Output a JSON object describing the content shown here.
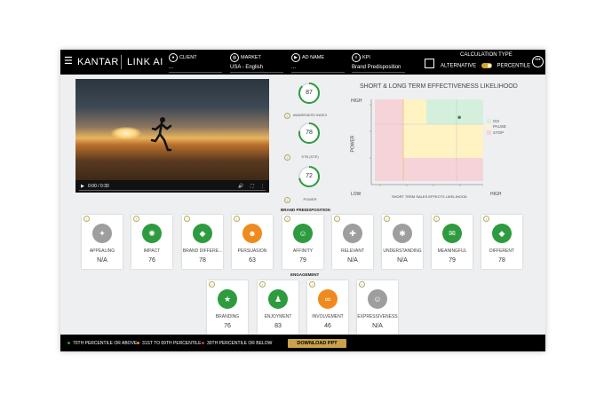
{
  "header": {
    "menu_icon": "hamburger-icon",
    "brand": "KANTAR",
    "product": "LINK AI",
    "client": {
      "label": "CLIENT",
      "value": "..."
    },
    "market": {
      "label": "MARKET",
      "value": "USA - English"
    },
    "ad_name": {
      "label": "AD NAME",
      "value": "..."
    },
    "kpi": {
      "label": "KPI",
      "value": "Brand Predisposition"
    },
    "calculation_type": {
      "title": "CALCULATION TYPE",
      "option_left": "ALTERNATIVE",
      "option_right": "PERCENTILE",
      "selected": "PERCENTILE"
    }
  },
  "video": {
    "time": "0:00 / 0:30"
  },
  "gauges": [
    {
      "value": "87",
      "label": "AWARENESS INDEX",
      "color": "#2e9b3f"
    },
    {
      "value": "78",
      "label": "STB (STE)",
      "color": "#2e9b3f"
    },
    {
      "value": "72",
      "label": "POWER",
      "color": "#2e9b3f"
    }
  ],
  "chart": {
    "title": "SHORT & LONG TERM EFFECTIVENESS LIKELIHOOD",
    "y_axis_label": "POWER",
    "y_high": "HIGH",
    "y_low": "LOW",
    "x_axis_label": "SHORT TERM SALES EFFECTS LIKELIHOOD",
    "x_high": "HIGH",
    "legend": [
      {
        "label": "GO",
        "color": "#d4f0dd"
      },
      {
        "label": "PAUSE",
        "color": "#fff3c4"
      },
      {
        "label": "STOP",
        "color": "#f6d3d8"
      }
    ]
  },
  "chart_data": {
    "type": "scatter",
    "title": "SHORT & LONG TERM EFFECTIVENESS LIKELIHOOD",
    "xlabel": "SHORT TERM SALES EFFECTS LIKELIHOOD",
    "ylabel": "POWER",
    "points": [
      {
        "x": 0.78,
        "y": 0.78
      }
    ],
    "xlim": [
      0,
      1
    ],
    "ylim": [
      0,
      1
    ],
    "zones": [
      "GO",
      "PAUSE",
      "STOP"
    ]
  },
  "brand_section": {
    "title": "BRAND PREDISPOSITION",
    "cards": [
      {
        "label": "APPEALING",
        "value": "N/A",
        "color": "#9e9e9e",
        "icon": "lightbulb-icon"
      },
      {
        "label": "IMPACT",
        "value": "76",
        "color": "#2e9b3f",
        "icon": "impact-icon"
      },
      {
        "label": "BRAND DIFFERE...",
        "value": "78",
        "color": "#2e9b3f",
        "icon": "diamond-icon"
      },
      {
        "label": "PERSUASION",
        "value": "63",
        "color": "#ef8b1e",
        "icon": "people-icon"
      },
      {
        "label": "AFFINITY",
        "value": "79",
        "color": "#2e9b3f",
        "icon": "head-icon"
      },
      {
        "label": "RELEVANT",
        "value": "N/A",
        "color": "#9e9e9e",
        "icon": "puzzle-icon"
      },
      {
        "label": "UNDERSTANDING",
        "value": "N/A",
        "color": "#9e9e9e",
        "icon": "mind-icon"
      },
      {
        "label": "MEANINGFUL",
        "value": "79",
        "color": "#2e9b3f",
        "icon": "chat-icon"
      },
      {
        "label": "DIFFERENT",
        "value": "78",
        "color": "#2e9b3f",
        "icon": "diamond-icon"
      }
    ]
  },
  "engagement_section": {
    "title": "ENGAGEMENT",
    "cards": [
      {
        "label": "BRANDING",
        "value": "76",
        "color": "#2e9b3f",
        "icon": "star-icon"
      },
      {
        "label": "ENJOYMENT",
        "value": "83",
        "color": "#2e9b3f",
        "icon": "person-icon"
      },
      {
        "label": "INVOLVEMENT",
        "value": "46",
        "color": "#ef8b1e",
        "icon": "link-icon"
      },
      {
        "label": "EXPRESSIVENESS",
        "value": "N/A",
        "color": "#9e9e9e",
        "icon": "face-icon"
      }
    ]
  },
  "footer": {
    "legend": [
      {
        "label": "70TH PERCENTILE OR ABOVE",
        "color": "#2e9b3f"
      },
      {
        "label": "31ST TO 69TH PERCENTILE",
        "color": "#ef8b1e"
      },
      {
        "label": "30TH PERCENTILE OR BELOW",
        "color": "#d9343f"
      }
    ],
    "download_label": "DOWNLOAD PPT"
  }
}
